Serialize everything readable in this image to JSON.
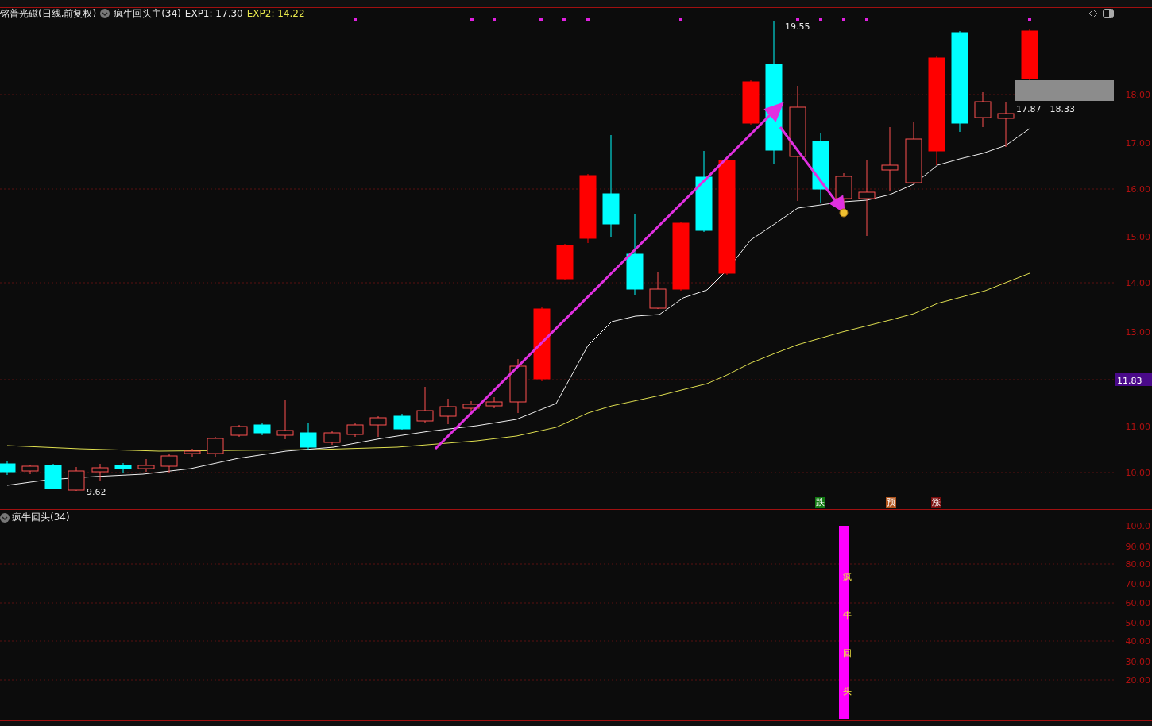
{
  "stock_header": {
    "name": "铭普光磁(日线,前复权)",
    "indicator": "疯牛回头主(34)",
    "exp1": "EXP1: 17.30",
    "exp2": "EXP2: 14.22"
  },
  "main_chart": {
    "high_label": "19.55",
    "low_label": "9.62",
    "range_label": "17.87 - 18.33",
    "price_axis": [
      "18.00",
      "17.00",
      "16.00",
      "15.00",
      "14.00",
      "13.00",
      "11.00",
      "10.00"
    ],
    "current_price": "11.83",
    "signals": [
      {
        "text": "跌",
        "color": "#137a13"
      },
      {
        "text": "预",
        "color": "#b0541c"
      },
      {
        "text": "涨",
        "color": "#7a0d0d"
      }
    ]
  },
  "sub_chart": {
    "title": "疯牛回头(34)",
    "bar_text": "疯牛回头",
    "axis": [
      "100.0",
      "90.00",
      "80.00",
      "70.00",
      "60.00",
      "50.00",
      "40.00",
      "30.00",
      "20.00"
    ]
  }
}
